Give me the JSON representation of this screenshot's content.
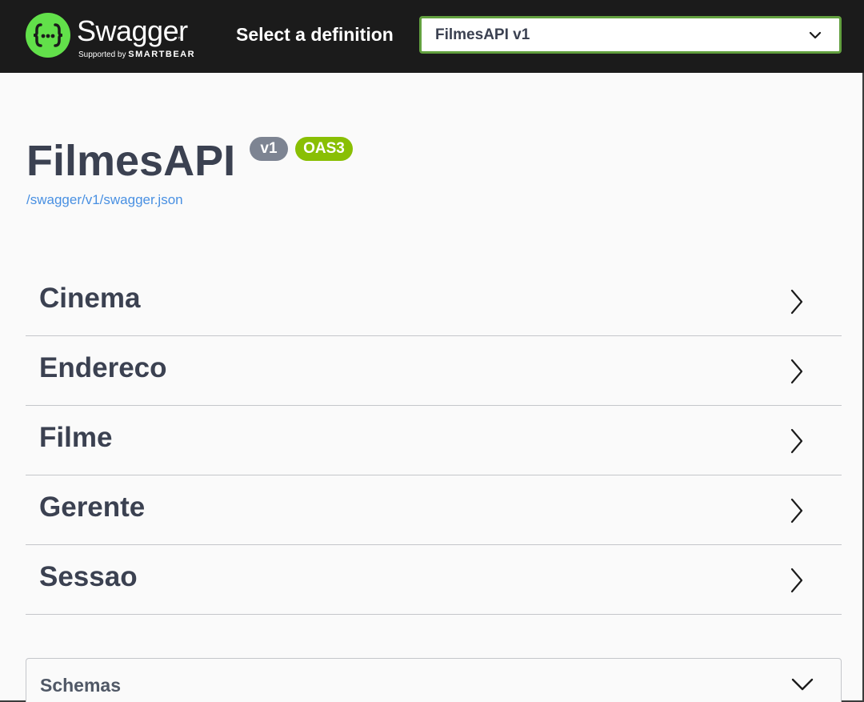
{
  "topbar": {
    "logo_text": "Swagger",
    "logo_tm": "™",
    "logo_supported_by": "Supported by",
    "logo_company": "SMARTBEAR",
    "logo_icon": "swagger-braces-icon",
    "select_label": "Select a definition",
    "selected_definition": "FilmesAPI v1",
    "brand_color": "#62e04a"
  },
  "info": {
    "title": "FilmesAPI",
    "version_badge": "v1",
    "oas_badge": "OAS3",
    "spec_link": "/swagger/v1/swagger.json"
  },
  "tags": [
    {
      "name": "Cinema"
    },
    {
      "name": "Endereco"
    },
    {
      "name": "Filme"
    },
    {
      "name": "Gerente"
    },
    {
      "name": "Sessao"
    }
  ],
  "schemas": {
    "title": "Schemas"
  }
}
